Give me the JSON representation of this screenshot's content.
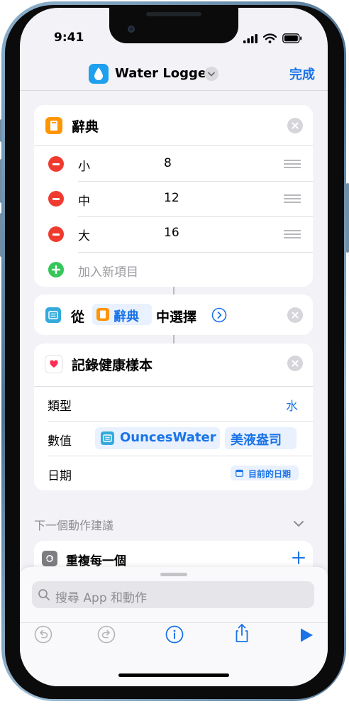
{
  "status_bar": {
    "time": "9:41"
  },
  "nav": {
    "title": "Water Logger",
    "done_label": "完成"
  },
  "dictionary_action": {
    "title": "辭典",
    "items": [
      {
        "key": "小",
        "value": "8"
      },
      {
        "key": "中",
        "value": "12"
      },
      {
        "key": "大",
        "value": "16"
      }
    ],
    "add_label": "加入新項目"
  },
  "choose_action": {
    "prefix": "從",
    "variable": "辭典",
    "suffix": "中選擇"
  },
  "health_action": {
    "title": "記錄健康樣本",
    "type_label": "類型",
    "type_value": "水",
    "value_label": "數值",
    "value_variable": "OuncesWater",
    "value_unit": "美液盎司",
    "date_label": "日期",
    "date_value": "目前的日期"
  },
  "suggestions": {
    "header": "下一個動作建議",
    "first_item": "重複每一個"
  },
  "search": {
    "placeholder": "搜尋 App 和動作"
  },
  "colors": {
    "accent": "#1A73E8",
    "remove": "#EF3B2F",
    "add": "#34C759",
    "app_icon": "#1EA0EE"
  }
}
